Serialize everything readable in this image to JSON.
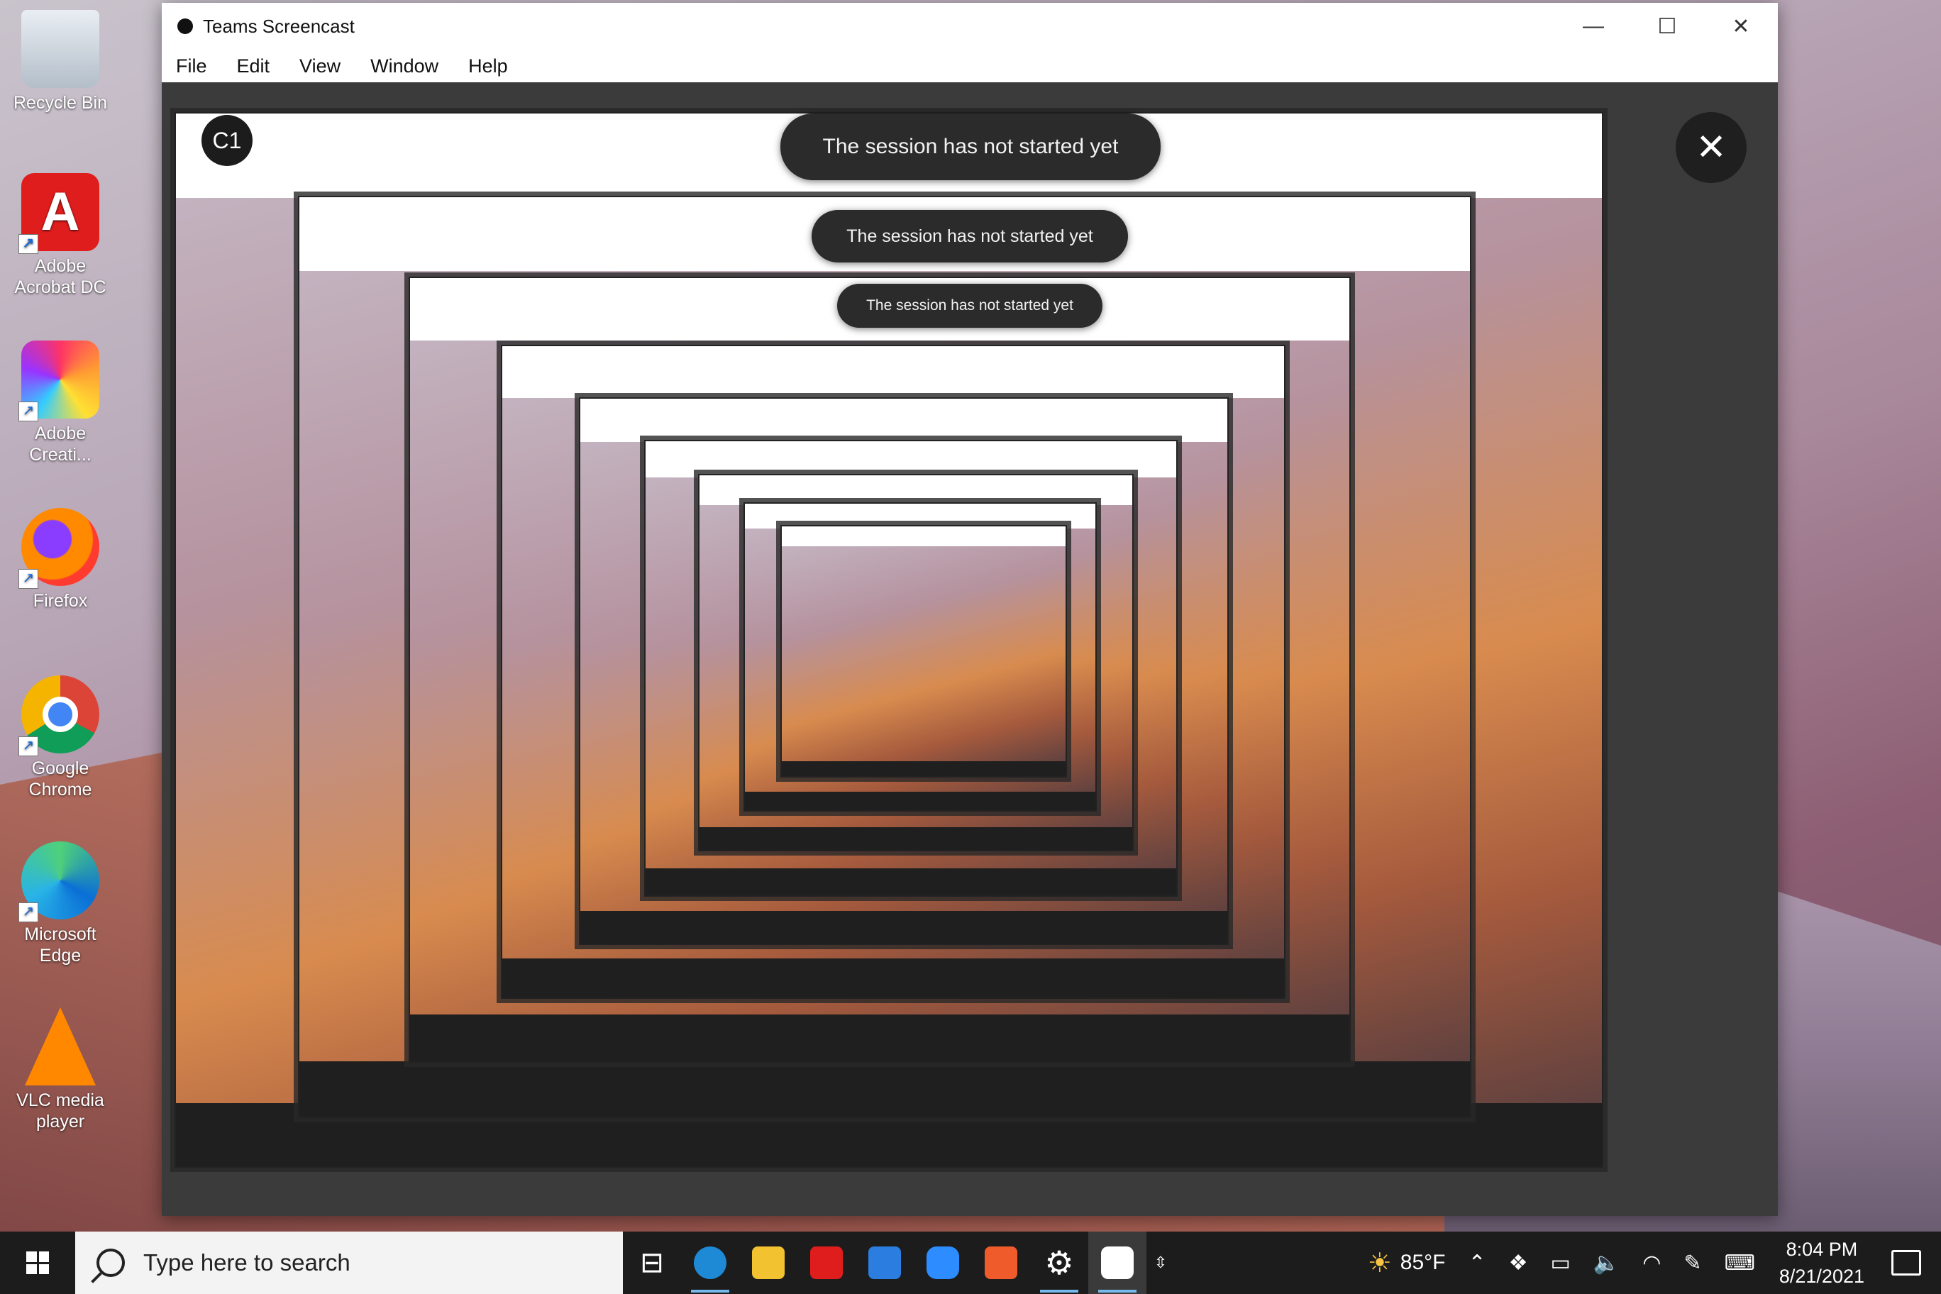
{
  "desktop": {
    "icons": [
      {
        "label": "Recycle Bin",
        "icon": "recycle-bin-icon"
      },
      {
        "label": "Adobe Acrobat DC",
        "icon": "acrobat-icon"
      },
      {
        "label": "Adobe Creati...",
        "icon": "creative-cloud-icon"
      },
      {
        "label": "Firefox",
        "icon": "firefox-icon"
      },
      {
        "label": "Google Chrome",
        "icon": "chrome-icon"
      },
      {
        "label": "Microsoft Edge",
        "icon": "edge-icon"
      },
      {
        "label": "VLC media player",
        "icon": "vlc-icon"
      }
    ]
  },
  "window": {
    "title": "Teams Screencast",
    "controls": {
      "minimize": "—",
      "maximize": "☐",
      "close": "✕"
    },
    "menu": [
      "File",
      "Edit",
      "View",
      "Window",
      "Help"
    ]
  },
  "session": {
    "toast": "The session has not started yet",
    "avatar": "C1",
    "close": "✕"
  },
  "taskbar": {
    "search_placeholder": "Type here to search",
    "apps": [
      {
        "name": "task-view-icon"
      },
      {
        "name": "edge-icon",
        "color": "#1e8ad6"
      },
      {
        "name": "file-explorer-icon",
        "color": "#f2c230"
      },
      {
        "name": "acrobat-icon",
        "color": "#e01d1d"
      },
      {
        "name": "mail-icon",
        "color": "#2b7de0"
      },
      {
        "name": "zoom-icon",
        "color": "#2d8cff"
      },
      {
        "name": "office-icon",
        "color": "#ef5b2b"
      },
      {
        "name": "settings-icon",
        "color": "#ffffff"
      },
      {
        "name": "teams-screencast-icon",
        "color": "#ffffff"
      }
    ],
    "weather": "85°F",
    "time": "8:04 PM",
    "date": "8/21/2021"
  }
}
